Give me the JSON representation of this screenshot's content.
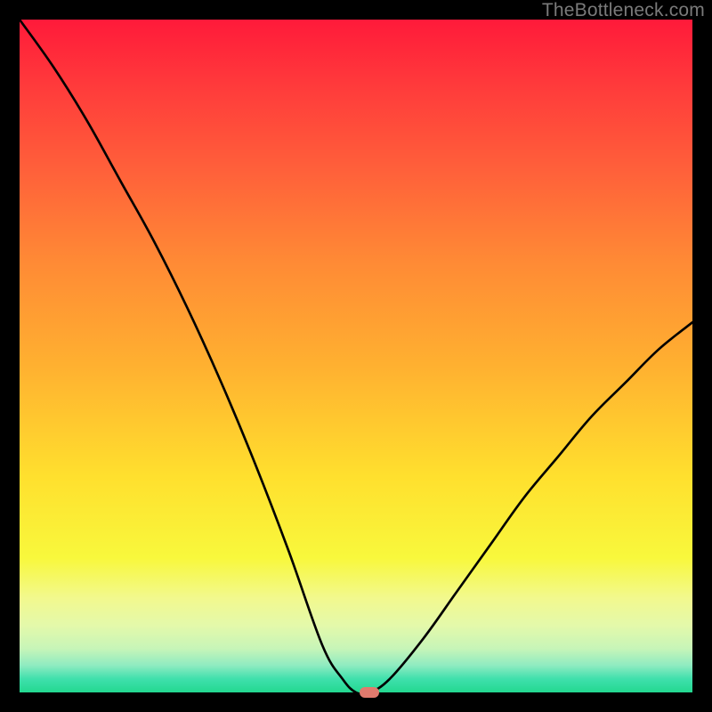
{
  "watermark": "TheBottleneck.com",
  "colors": {
    "frame": "#000000",
    "curve": "#000000",
    "marker": "#e07a6d",
    "watermark": "#7a7a7a",
    "gradient_top": "#ff1a3a",
    "gradient_bottom": "#23d890"
  },
  "chart_data": {
    "type": "line",
    "title": "",
    "xlabel": "",
    "ylabel": "",
    "xlim": [
      0,
      100
    ],
    "ylim": [
      0,
      100
    ],
    "grid": false,
    "x": [
      0,
      5,
      10,
      15,
      20,
      25,
      30,
      35,
      40,
      45,
      48,
      50,
      52,
      55,
      60,
      65,
      70,
      75,
      80,
      85,
      90,
      95,
      100
    ],
    "y": [
      100,
      93,
      85,
      76,
      67,
      57,
      46,
      34,
      21,
      7,
      2,
      0,
      0,
      2,
      8,
      15,
      22,
      29,
      35,
      41,
      46,
      51,
      55
    ],
    "marker": {
      "x": 52,
      "y": 0
    },
    "notes": "y represents bottleneck percentage; minimum (optimal balance) occurs around x≈50–53 with y≈0."
  }
}
